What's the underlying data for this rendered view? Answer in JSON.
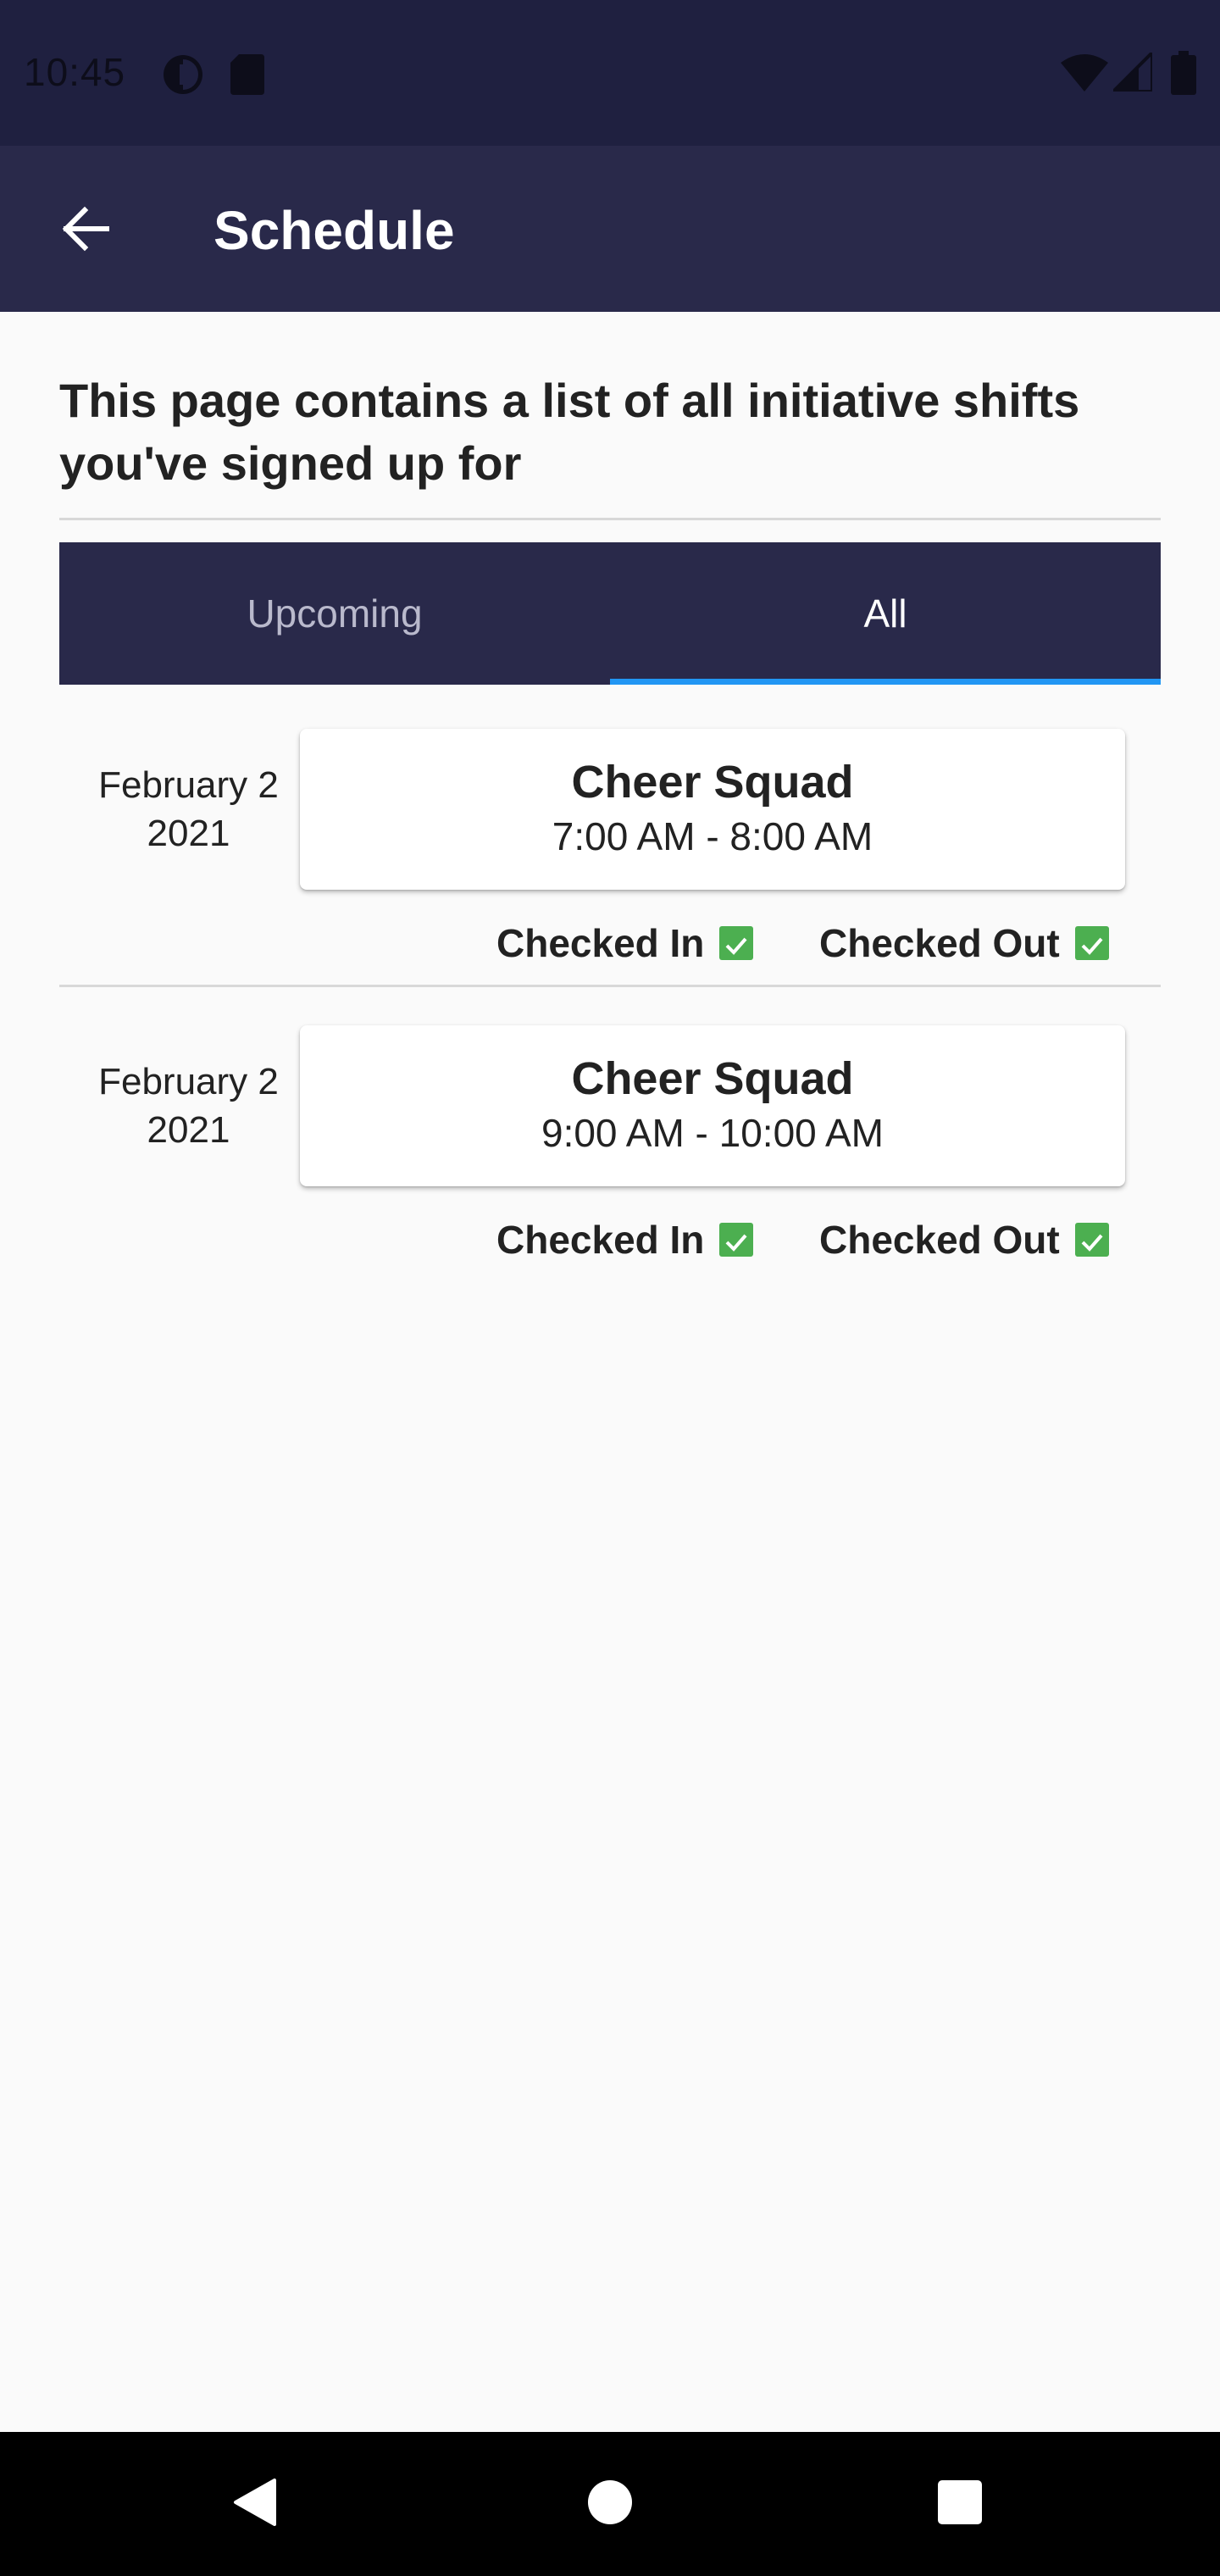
{
  "status_bar": {
    "time": "10:45",
    "icons": [
      "data-saver-icon",
      "sd-card-icon",
      "wifi-icon",
      "signal-icon",
      "battery-icon"
    ]
  },
  "app_bar": {
    "title": "Schedule",
    "back_icon": "arrow-back-icon"
  },
  "intro_text": "This page contains a list of all initiative shifts you've signed up for",
  "tabs": [
    {
      "label": "Upcoming",
      "selected": false
    },
    {
      "label": "All",
      "selected": true
    }
  ],
  "shifts": [
    {
      "date_line1": "February 2",
      "date_line2": "2021",
      "name": "Cheer Squad",
      "time": "7:00 AM - 8:00 AM",
      "checked_in_label": "Checked In",
      "checked_in": true,
      "checked_out_label": "Checked Out",
      "checked_out": true
    },
    {
      "date_line1": "February 2",
      "date_line2": "2021",
      "name": "Cheer Squad",
      "time": "9:00 AM - 10:00 AM",
      "checked_in_label": "Checked In",
      "checked_in": true,
      "checked_out_label": "Checked Out",
      "checked_out": true
    }
  ],
  "nav_bar": {
    "icons": [
      "back-triangle-icon",
      "home-circle-icon",
      "recents-square-icon"
    ]
  },
  "colors": {
    "status_bar": "#1f2040",
    "app_bar": "#29294a",
    "tab_indicator": "#2196f3",
    "check_green": "#4caf50"
  }
}
